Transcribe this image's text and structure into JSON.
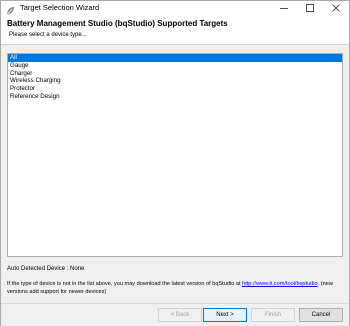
{
  "window": {
    "title": "Target Selection Wizard",
    "icon": "bqstudio-leaf-icon",
    "accent_color": "#0078d7"
  },
  "header": {
    "heading": "Battery Management Studio (bqStudio) Supported Targets",
    "subheading": "Please select a device type..."
  },
  "device_list": {
    "items": [
      "All",
      "Gauge",
      "Charger",
      "Wireless Charging",
      "Protector",
      "Reference Design"
    ],
    "selected": "All"
  },
  "auto_detected": "Auto Detected Device : None",
  "info": {
    "text_before": "If the type of device is not in the list above, you may download the latest version of bqStudio at ",
    "link": "http://www.ti.com/tool/bqstudio",
    "text_after": ". (new versions add support for newer devices)"
  },
  "buttons": {
    "back": "< Back",
    "next": "Next >",
    "finish": "Finish",
    "cancel": "Cancel"
  }
}
